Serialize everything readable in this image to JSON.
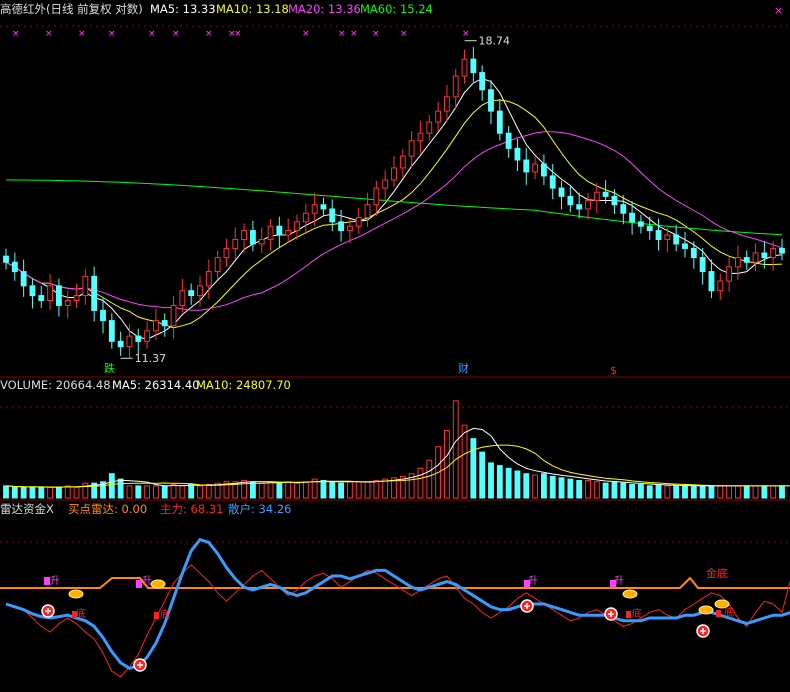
{
  "colors": {
    "background": "#000000",
    "up": "#ff3030",
    "down": "#54ffff",
    "ma5": "#ffffff",
    "ma10": "#ffff00",
    "ma20": "#ff40ff",
    "ma60": "#00ff00",
    "label_text": "#dcdcdc",
    "main_force": "#ff2020",
    "retail": "#3a9bff",
    "orange_line": "#ff8c00",
    "grid": "#8b0000"
  },
  "price_panel": {
    "title": "高德红外(日线 前复权 对数)",
    "ma5_label": "MA5: 13.33",
    "ma10_label": "MA10: 13.18",
    "ma20_label": "MA20: 13.36",
    "ma60_label": "MA60: 15.24",
    "max_label": "18.74",
    "min_label": "11.37",
    "event_die": "跌",
    "event_cai": "财",
    "event_dollar": "$"
  },
  "volume_panel": {
    "volume_label": "VOLUME: 20664.48",
    "ma5_label": "MA5: 26314.40",
    "ma10_label": "MA10: 24807.70"
  },
  "radar_panel": {
    "title": "雷达资金X",
    "buy_label": "买点雷达: 0.00",
    "main_label": "主力: 68.31",
    "retail_label": "散户: 34.26",
    "jin_di": "金底",
    "sheng": "升",
    "di": "底"
  },
  "chart_data": {
    "type": "candlestick",
    "y_scale": "log",
    "close": [
      13.1,
      12.9,
      12.6,
      12.4,
      12.3,
      12.6,
      12.2,
      12.3,
      12.4,
      12.8,
      12.1,
      11.9,
      11.5,
      11.4,
      11.6,
      11.5,
      11.7,
      11.9,
      11.8,
      12.2,
      12.5,
      12.4,
      12.6,
      12.9,
      13.2,
      13.4,
      13.6,
      13.8,
      13.5,
      13.6,
      13.9,
      13.7,
      13.8,
      14.0,
      14.2,
      14.4,
      14.3,
      14.0,
      13.8,
      13.9,
      14.1,
      14.4,
      14.8,
      15.0,
      15.3,
      15.6,
      16.0,
      16.2,
      16.5,
      16.8,
      17.2,
      17.8,
      18.3,
      17.9,
      17.4,
      16.8,
      16.2,
      15.8,
      15.5,
      15.2,
      15.4,
      15.1,
      14.8,
      14.6,
      14.4,
      14.3,
      14.5,
      14.7,
      14.6,
      14.4,
      14.2,
      14.0,
      13.9,
      13.8,
      13.6,
      13.7,
      13.5,
      13.4,
      13.2,
      12.9,
      12.5,
      12.7,
      13.0,
      13.2,
      13.1,
      13.3,
      13.2,
      13.4,
      13.3
    ],
    "y_range": [
      11.3,
      19.2
    ],
    "max_close": 18.74,
    "min_close": 11.37,
    "volume": [
      9,
      8,
      8,
      8,
      8,
      8,
      8,
      9,
      8,
      11,
      11,
      12,
      18,
      14,
      9,
      9,
      9,
      9,
      9,
      10,
      9,
      10,
      9,
      10,
      11,
      12,
      12,
      13,
      12,
      11,
      12,
      11,
      12,
      11,
      12,
      14,
      13,
      12,
      11,
      12,
      12,
      12,
      13,
      14,
      15,
      16,
      18,
      22,
      28,
      38,
      50,
      72,
      54,
      44,
      34,
      26,
      24,
      22,
      20,
      18,
      17,
      18,
      16,
      15,
      14,
      13,
      13,
      12,
      11,
      12,
      11,
      10,
      10,
      9,
      10,
      9,
      9,
      9,
      9,
      9,
      9,
      9,
      9,
      9,
      9,
      9,
      9,
      9,
      9,
      9
    ],
    "main_force": [
      40,
      38,
      36,
      30,
      24,
      20,
      26,
      30,
      26,
      20,
      15,
      5,
      -8,
      -12,
      -5,
      4,
      18,
      30,
      42,
      55,
      62,
      68,
      62,
      56,
      48,
      42,
      48,
      54,
      60,
      64,
      58,
      52,
      46,
      50,
      56,
      60,
      62,
      58,
      52,
      56,
      60,
      64,
      62,
      58,
      54,
      50,
      46,
      50,
      54,
      58,
      60,
      52,
      44,
      40,
      34,
      30,
      34,
      38,
      44,
      48,
      44,
      40,
      36,
      32,
      28,
      30,
      34,
      36,
      32,
      28,
      24,
      26,
      30,
      34,
      36,
      32,
      30,
      36,
      40,
      44,
      48,
      46,
      40,
      30,
      24,
      34,
      42,
      40,
      34,
      58,
      68
    ],
    "retail": [
      40,
      38,
      36,
      33,
      31,
      30,
      31,
      32,
      30,
      28,
      24,
      16,
      6,
      -2,
      -6,
      -4,
      2,
      12,
      26,
      44,
      62,
      78,
      86,
      84,
      76,
      66,
      58,
      52,
      50,
      52,
      54,
      52,
      48,
      46,
      48,
      52,
      56,
      60,
      60,
      58,
      60,
      62,
      64,
      64,
      60,
      56,
      52,
      50,
      52,
      54,
      56,
      54,
      50,
      46,
      42,
      38,
      36,
      36,
      38,
      40,
      40,
      40,
      38,
      36,
      34,
      32,
      32,
      32,
      32,
      30,
      28,
      28,
      28,
      30,
      30,
      30,
      30,
      32,
      32,
      34,
      34,
      32,
      30,
      28,
      26,
      28,
      30,
      32,
      32,
      34,
      34
    ],
    "radar_range": [
      -20,
      100
    ]
  }
}
